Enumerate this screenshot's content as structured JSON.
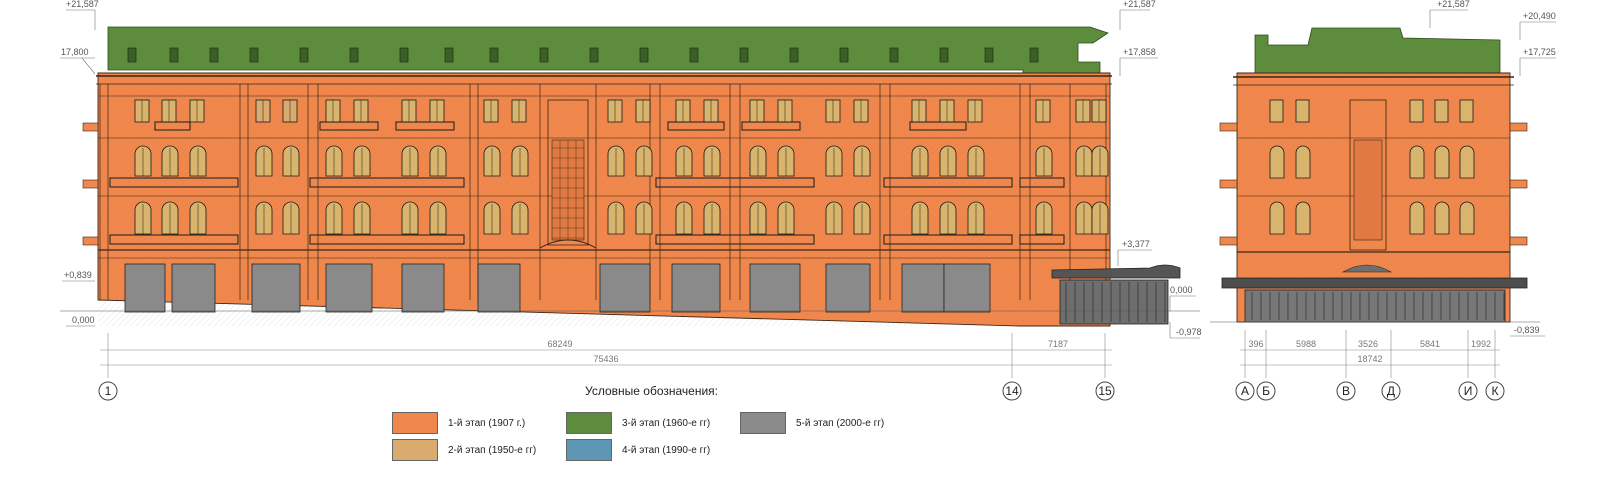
{
  "colors": {
    "stage1": "#f0884e",
    "stage2": "#d9ab6f",
    "stage3": "#5c8c3c",
    "stage4": "#5e97b5",
    "stage5": "#8a8a8a",
    "line": "#3a2414",
    "window_glass": "#d9b46c"
  },
  "levels": {
    "main_top": "+21,587",
    "main_cornice": "17,800",
    "main_right_top": "+21,587",
    "main_right_cornice": "+17,858",
    "main_left_ground": "+0,839",
    "main_left_zero": "0,000",
    "main_canopy": "+3,377",
    "main_right_zero": "0,000",
    "main_right_low": "-0,978",
    "side_top": "+21,587",
    "side_roof": "+20,490",
    "side_cornice": "+17,725",
    "side_low": "-0,839"
  },
  "dimensions": {
    "main": [
      "68249",
      "7187",
      "75436"
    ],
    "side": [
      "396",
      "5988",
      "3526",
      "5841",
      "1992",
      "18742"
    ]
  },
  "axes": {
    "main": [
      "1",
      "14",
      "15"
    ],
    "side": [
      "А",
      "Б",
      "В",
      "Д",
      "И",
      "К"
    ]
  },
  "legend": {
    "title": "Условные обозначения:",
    "items": [
      {
        "label": "1-й этап (1907 г.)"
      },
      {
        "label": "2-й этап (1950-е гг)"
      },
      {
        "label": "3-й этап (1960-е гг)"
      },
      {
        "label": "4-й этап (1990-е гг)"
      },
      {
        "label": "5-й этап (2000-е гг)"
      }
    ]
  }
}
